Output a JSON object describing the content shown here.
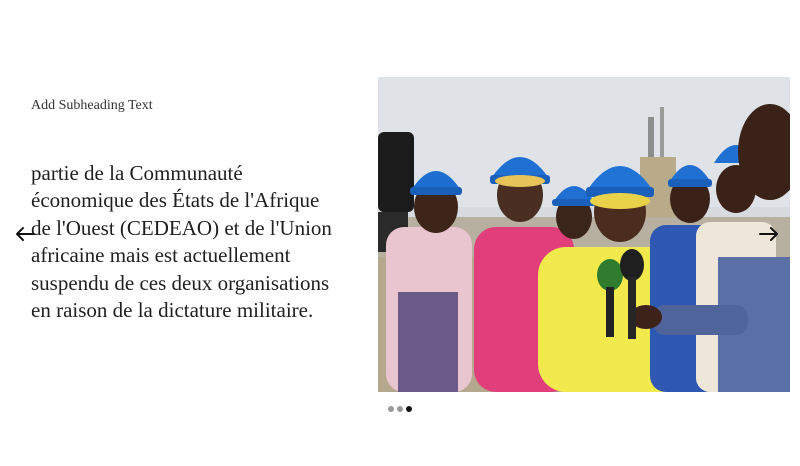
{
  "slide": {
    "subheading": "Add Subheading Text",
    "body_lines": [
      "partie de la Communauté",
      "économique des États de l'Afrique",
      "de l'Ouest (CEDEAO) et de l'Union",
      "africaine mais est actuellement",
      "suspendu de ces deux organisations",
      "en raison de la dictature militaire."
    ]
  },
  "carousel": {
    "prev_icon": "arrow-left-icon",
    "next_icon": "arrow-right-icon",
    "dots_total": 3,
    "active_dot": 3
  },
  "photo": {
    "description_icon": "photo",
    "colors": {
      "sky": "#d9dde2",
      "helmet": "#1f6fd1",
      "pink_dress": "#e0417e",
      "yellow_dress": "#f2ea4a",
      "skin": "#4a2e22"
    }
  }
}
